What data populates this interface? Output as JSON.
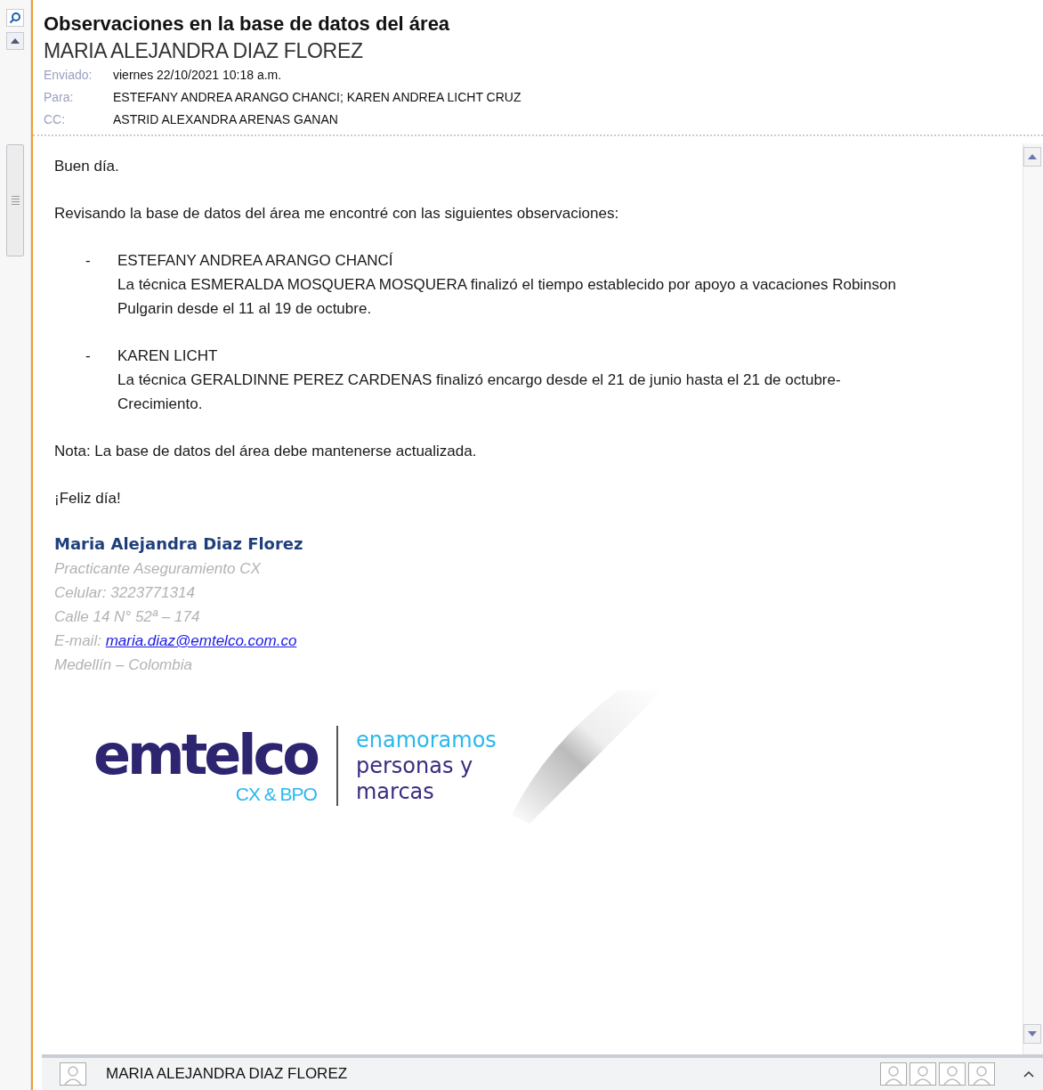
{
  "reading_pane": {
    "subject": "Observaciones en la base de datos del área",
    "sender": "MARIA ALEJANDRA DIAZ FLOREZ",
    "headers": [
      {
        "label": "Enviado:",
        "value": "viernes 22/10/2021 10:18 a.m."
      },
      {
        "label": "Para:",
        "value": "ESTEFANY ANDREA ARANGO CHANCI; KAREN ANDREA LICHT CRUZ"
      },
      {
        "label": "CC:",
        "value": "ASTRID ALEXANDRA ARENAS GANAN"
      }
    ],
    "body": {
      "greeting": "Buen día.",
      "intro": "Revisando la base de datos del área me encontré con las siguientes observaciones:",
      "items": [
        {
          "bullet": "-",
          "title": "ESTEFANY ANDREA ARANGO CHANCÍ",
          "text": "La técnica ESMERALDA MOSQUERA MOSQUERA finalizó el tiempo establecido por apoyo a vacaciones Robinson Pulgarin desde el 11 al 19 de octubre."
        },
        {
          "bullet": "-",
          "title": "KAREN LICHT",
          "text": "La técnica GERALDINNE PEREZ CARDENAS finalizó encargo desde el 21 de junio hasta el 21 de octubre-Crecimiento."
        }
      ],
      "note": "Nota: La base de datos del área debe mantenerse actualizada.",
      "closing": "¡Feliz día!",
      "signature": {
        "name": "Maria Alejandra Diaz Florez",
        "lines": [
          "Practicante Aseguramiento CX",
          "Celular: 3223771314",
          "Calle 14 N° 52ª – 174"
        ],
        "email_label": "E-mail:",
        "email": "maria.diaz@emtelco.com.co",
        "city": "Medellín – Colombia"
      },
      "logo": {
        "brand": "emtelco",
        "sub": "CX & BPO",
        "slogan": [
          "enamoramos",
          "personas y",
          "marcas"
        ]
      }
    }
  },
  "people_pane": {
    "name": "MARIA ALEJANDRA DIAZ FLOREZ",
    "contacts": [
      {
        "kind": "person"
      },
      {
        "kind": "person"
      },
      {
        "kind": "person"
      },
      {
        "kind": "person"
      }
    ]
  }
}
